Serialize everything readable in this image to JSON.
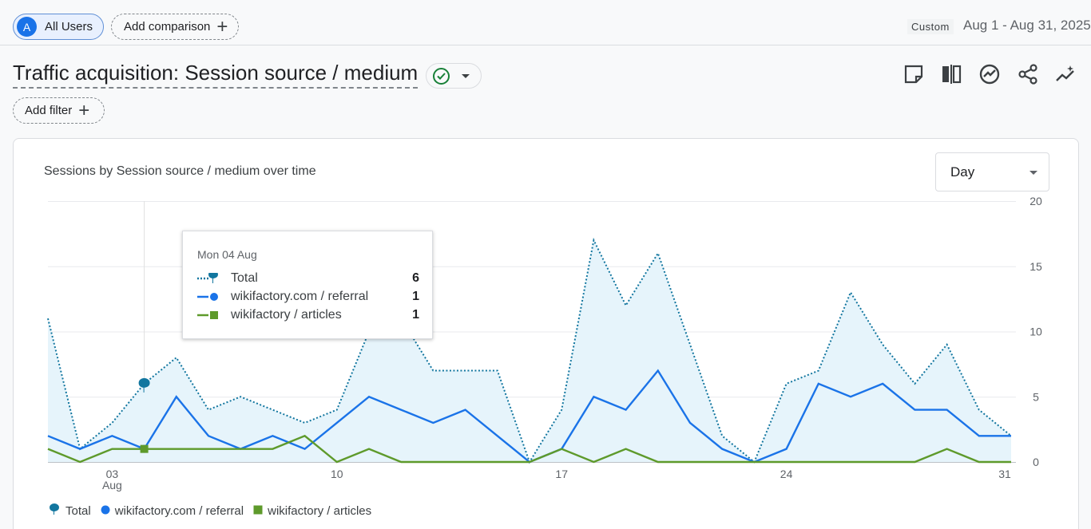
{
  "header": {
    "segment_avatar": "A",
    "segment_label": "All Users",
    "add_comparison": "Add comparison",
    "date_custom": "Custom",
    "date_range": "Aug 1 - Aug 31, 2025"
  },
  "title": "Traffic acquisition: Session source / medium",
  "add_filter": "Add filter",
  "card": {
    "title": "Sessions by Session source / medium over time",
    "granularity": "Day"
  },
  "tooltip": {
    "date": "Mon 04 Aug",
    "rows": [
      {
        "name": "Total",
        "value": "6"
      },
      {
        "name": "wikifactory.com / referral",
        "value": "1"
      },
      {
        "name": "wikifactory / articles",
        "value": "1"
      }
    ]
  },
  "legend": [
    "Total",
    "wikifactory.com / referral",
    "wikifactory / articles"
  ],
  "colors": {
    "total": "#12769f",
    "referral": "#1a73e8",
    "articles": "#5e9a2b",
    "area": "#e6f4fb"
  },
  "chart_data": {
    "type": "line",
    "x_tick_labels": [
      "03",
      "Aug",
      "10",
      "17",
      "24",
      "31"
    ],
    "y_tick_labels": [
      "0",
      "5",
      "10",
      "15",
      "20"
    ],
    "ylim": [
      0,
      20
    ],
    "x": [
      1,
      2,
      3,
      4,
      5,
      6,
      7,
      8,
      9,
      10,
      11,
      12,
      13,
      14,
      15,
      16,
      17,
      18,
      19,
      20,
      21,
      22,
      23,
      24,
      25,
      26,
      27,
      28,
      29,
      30,
      31
    ],
    "series": [
      {
        "name": "Total",
        "values": [
          11,
          1,
          3,
          6,
          8,
          4,
          5,
          4,
          3,
          4,
          10,
          11,
          7,
          7,
          7,
          0,
          4,
          17,
          12,
          16,
          9,
          2,
          0,
          6,
          7,
          13,
          9,
          6,
          9,
          4,
          2
        ]
      },
      {
        "name": "wikifactory.com / referral",
        "values": [
          2,
          1,
          2,
          1,
          5,
          2,
          1,
          2,
          1,
          3,
          5,
          4,
          3,
          4,
          2,
          0,
          1,
          5,
          4,
          7,
          3,
          1,
          0,
          1,
          6,
          5,
          6,
          4,
          4,
          2,
          2
        ]
      },
      {
        "name": "wikifactory / articles",
        "values": [
          1,
          0,
          1,
          1,
          1,
          1,
          1,
          1,
          2,
          0,
          1,
          0,
          0,
          0,
          0,
          0,
          1,
          0,
          1,
          0,
          0,
          0,
          0,
          0,
          0,
          0,
          0,
          0,
          1,
          0,
          0
        ]
      }
    ],
    "grid": true,
    "legend_position": "bottom-left"
  }
}
